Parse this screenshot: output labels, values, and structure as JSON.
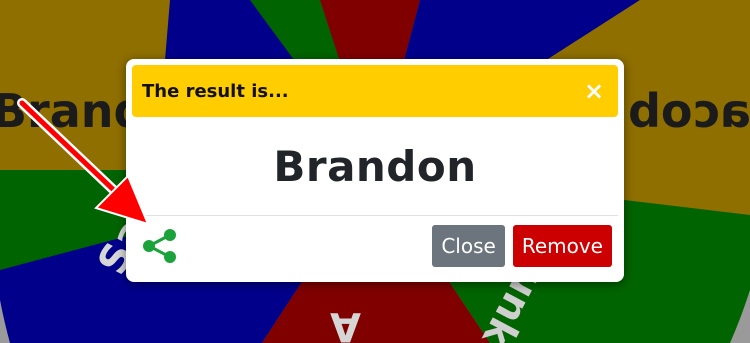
{
  "wheel": {
    "segment_colors": {
      "olive": "#8f6f00",
      "navy": "#00008b",
      "green": "#006400",
      "maroon": "#800000",
      "grey_rim": "#9a9a9a"
    },
    "labels": {
      "left": "Brandon",
      "right": "Jacob",
      "bottom_left": "Sarah",
      "bottom_mid": "A",
      "bottom_right": "Hunk"
    }
  },
  "dialog": {
    "title": "The result is...",
    "close_icon": "×",
    "result": "Brandon",
    "buttons": {
      "close": "Close",
      "remove": "Remove"
    },
    "colors": {
      "header": "#ffcd00",
      "share_icon": "#1aa33a",
      "close_button": "#6c757d",
      "remove_button": "#cc0000"
    }
  },
  "annotation": {
    "arrow_color": "#ff0000"
  }
}
